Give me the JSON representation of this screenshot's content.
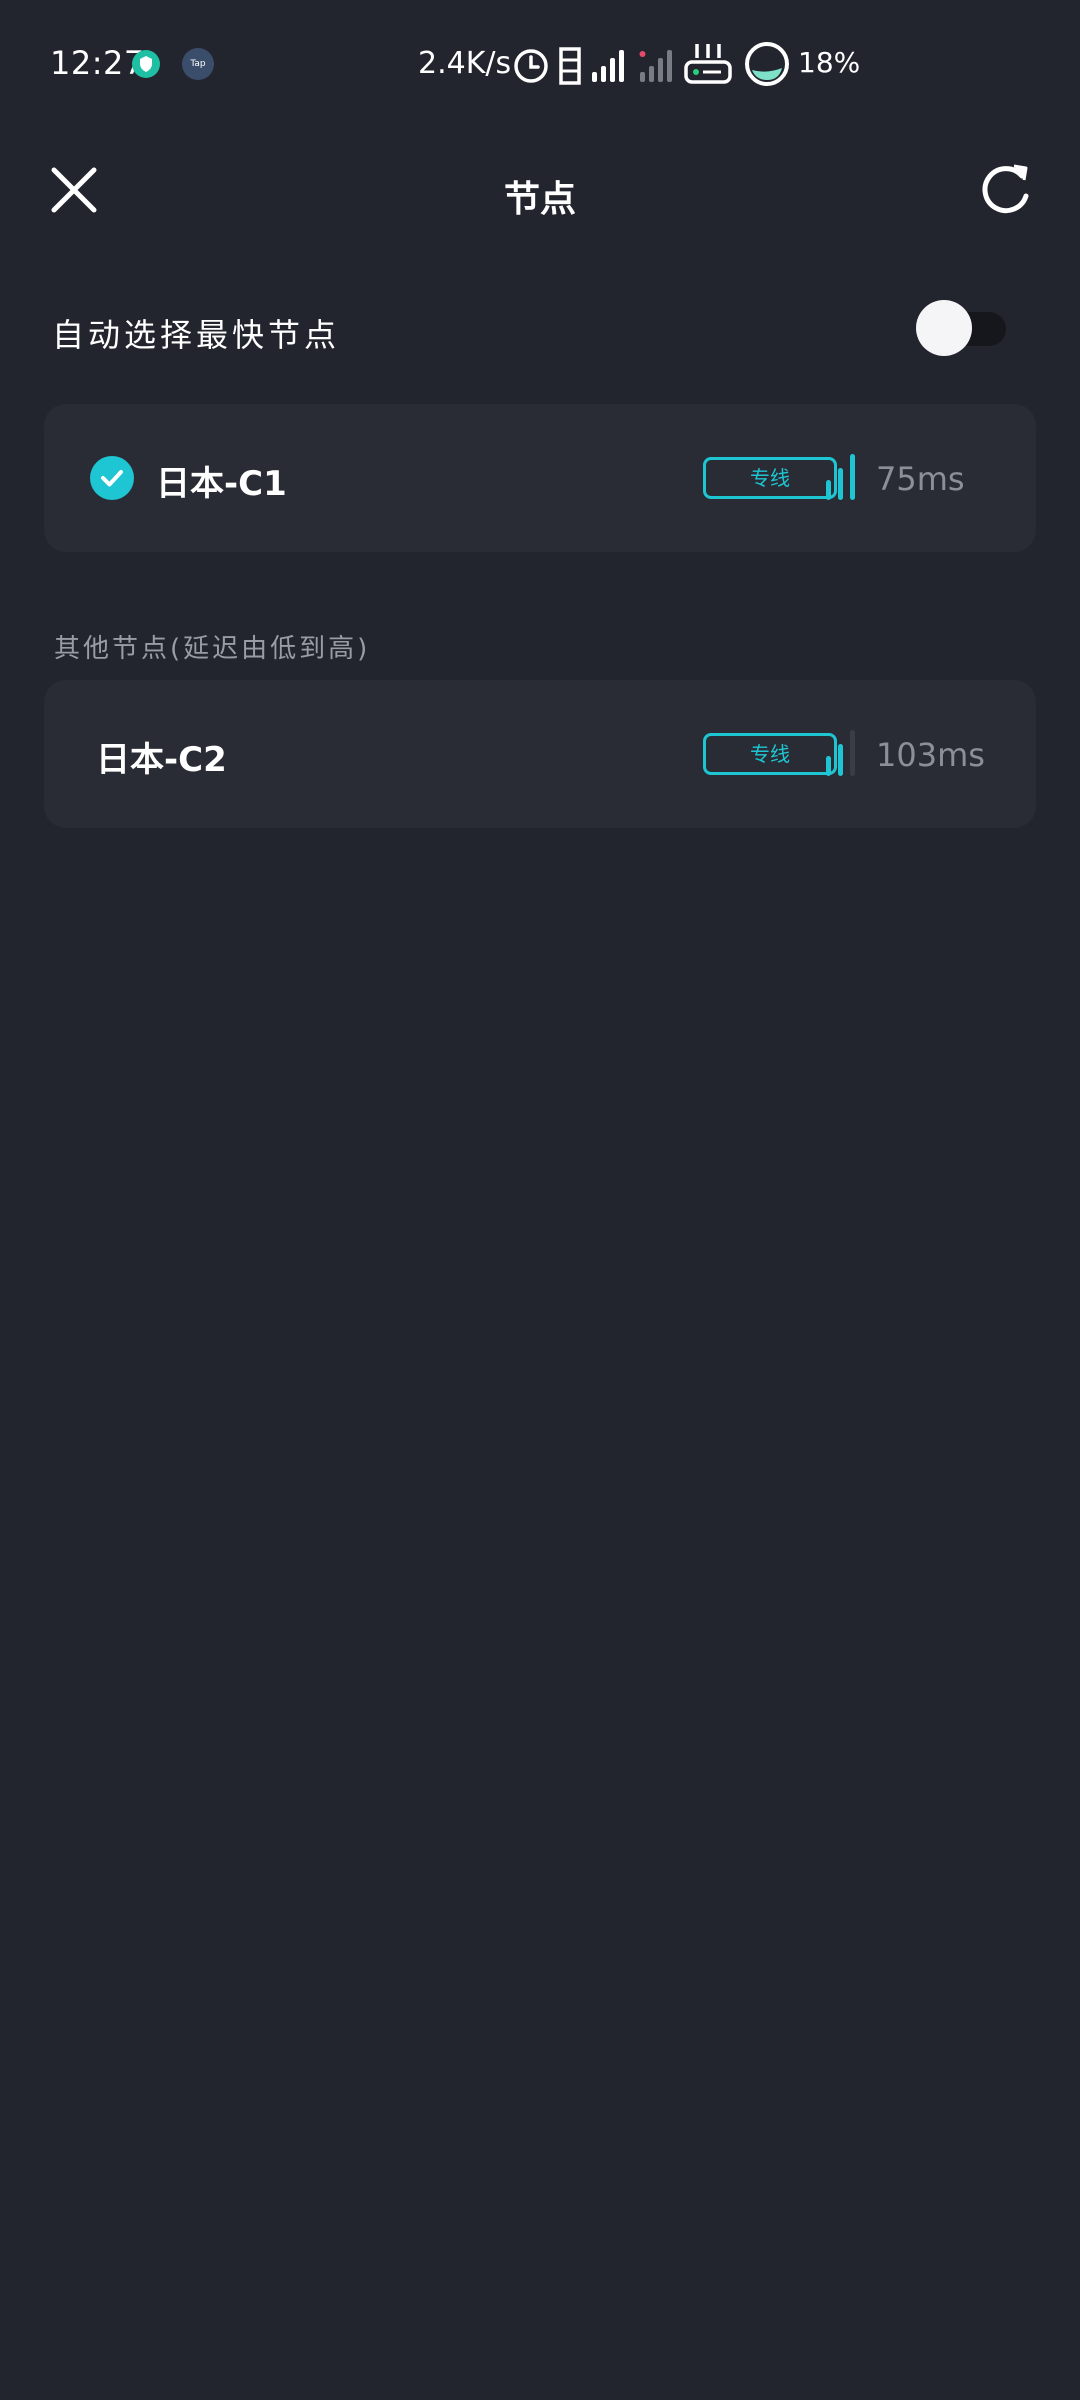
{
  "status_bar": {
    "time": "12:27",
    "tap_label": "Tap",
    "net_speed": "2.4K/s",
    "battery": "18%",
    "icons": [
      "shield-icon",
      "tap-app-icon",
      "clock-icon",
      "sim-icon",
      "signal-icon",
      "signal-weak-icon",
      "router-icon",
      "battery-ring-icon"
    ]
  },
  "header": {
    "title": "节点",
    "close_icon": "close-icon",
    "refresh_icon": "refresh-icon"
  },
  "auto_select": {
    "label": "自动选择最快节点",
    "enabled": false
  },
  "selected_node": {
    "name": "日本-C1",
    "tag": "专线",
    "latency": "75ms",
    "signal_bars_lit": 3,
    "selected": true
  },
  "other_section": {
    "label": "其他节点(延迟由低到高)"
  },
  "other_nodes": [
    {
      "name": "日本-C2",
      "tag": "专线",
      "latency": "103ms",
      "signal_bars_lit": 2
    }
  ],
  "colors": {
    "background": "#23252e",
    "card": "#2a2c35",
    "accent": "#1dc6d2",
    "muted_text": "#8c8f98"
  }
}
